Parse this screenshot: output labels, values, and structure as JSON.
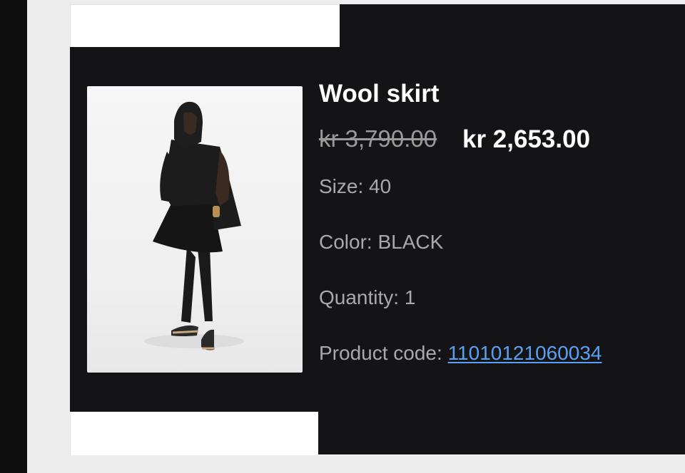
{
  "product": {
    "name": "Wool skirt",
    "original_price": "kr 3,790.00",
    "sale_price": "kr 2,653.00",
    "size_label": "Size: ",
    "size_value": "40",
    "color_label": "Color: ",
    "color_value": "BLACK",
    "quantity_label": "Quantity: ",
    "quantity_value": "1",
    "code_label": "Product code: ",
    "code_value": "11010121060034"
  },
  "colors": {
    "card_background": "#141416",
    "page_background": "#ededed",
    "link": "#5aa0f2",
    "muted_text": "#a9a9ab",
    "strikethrough_text": "#9a9a9a"
  }
}
